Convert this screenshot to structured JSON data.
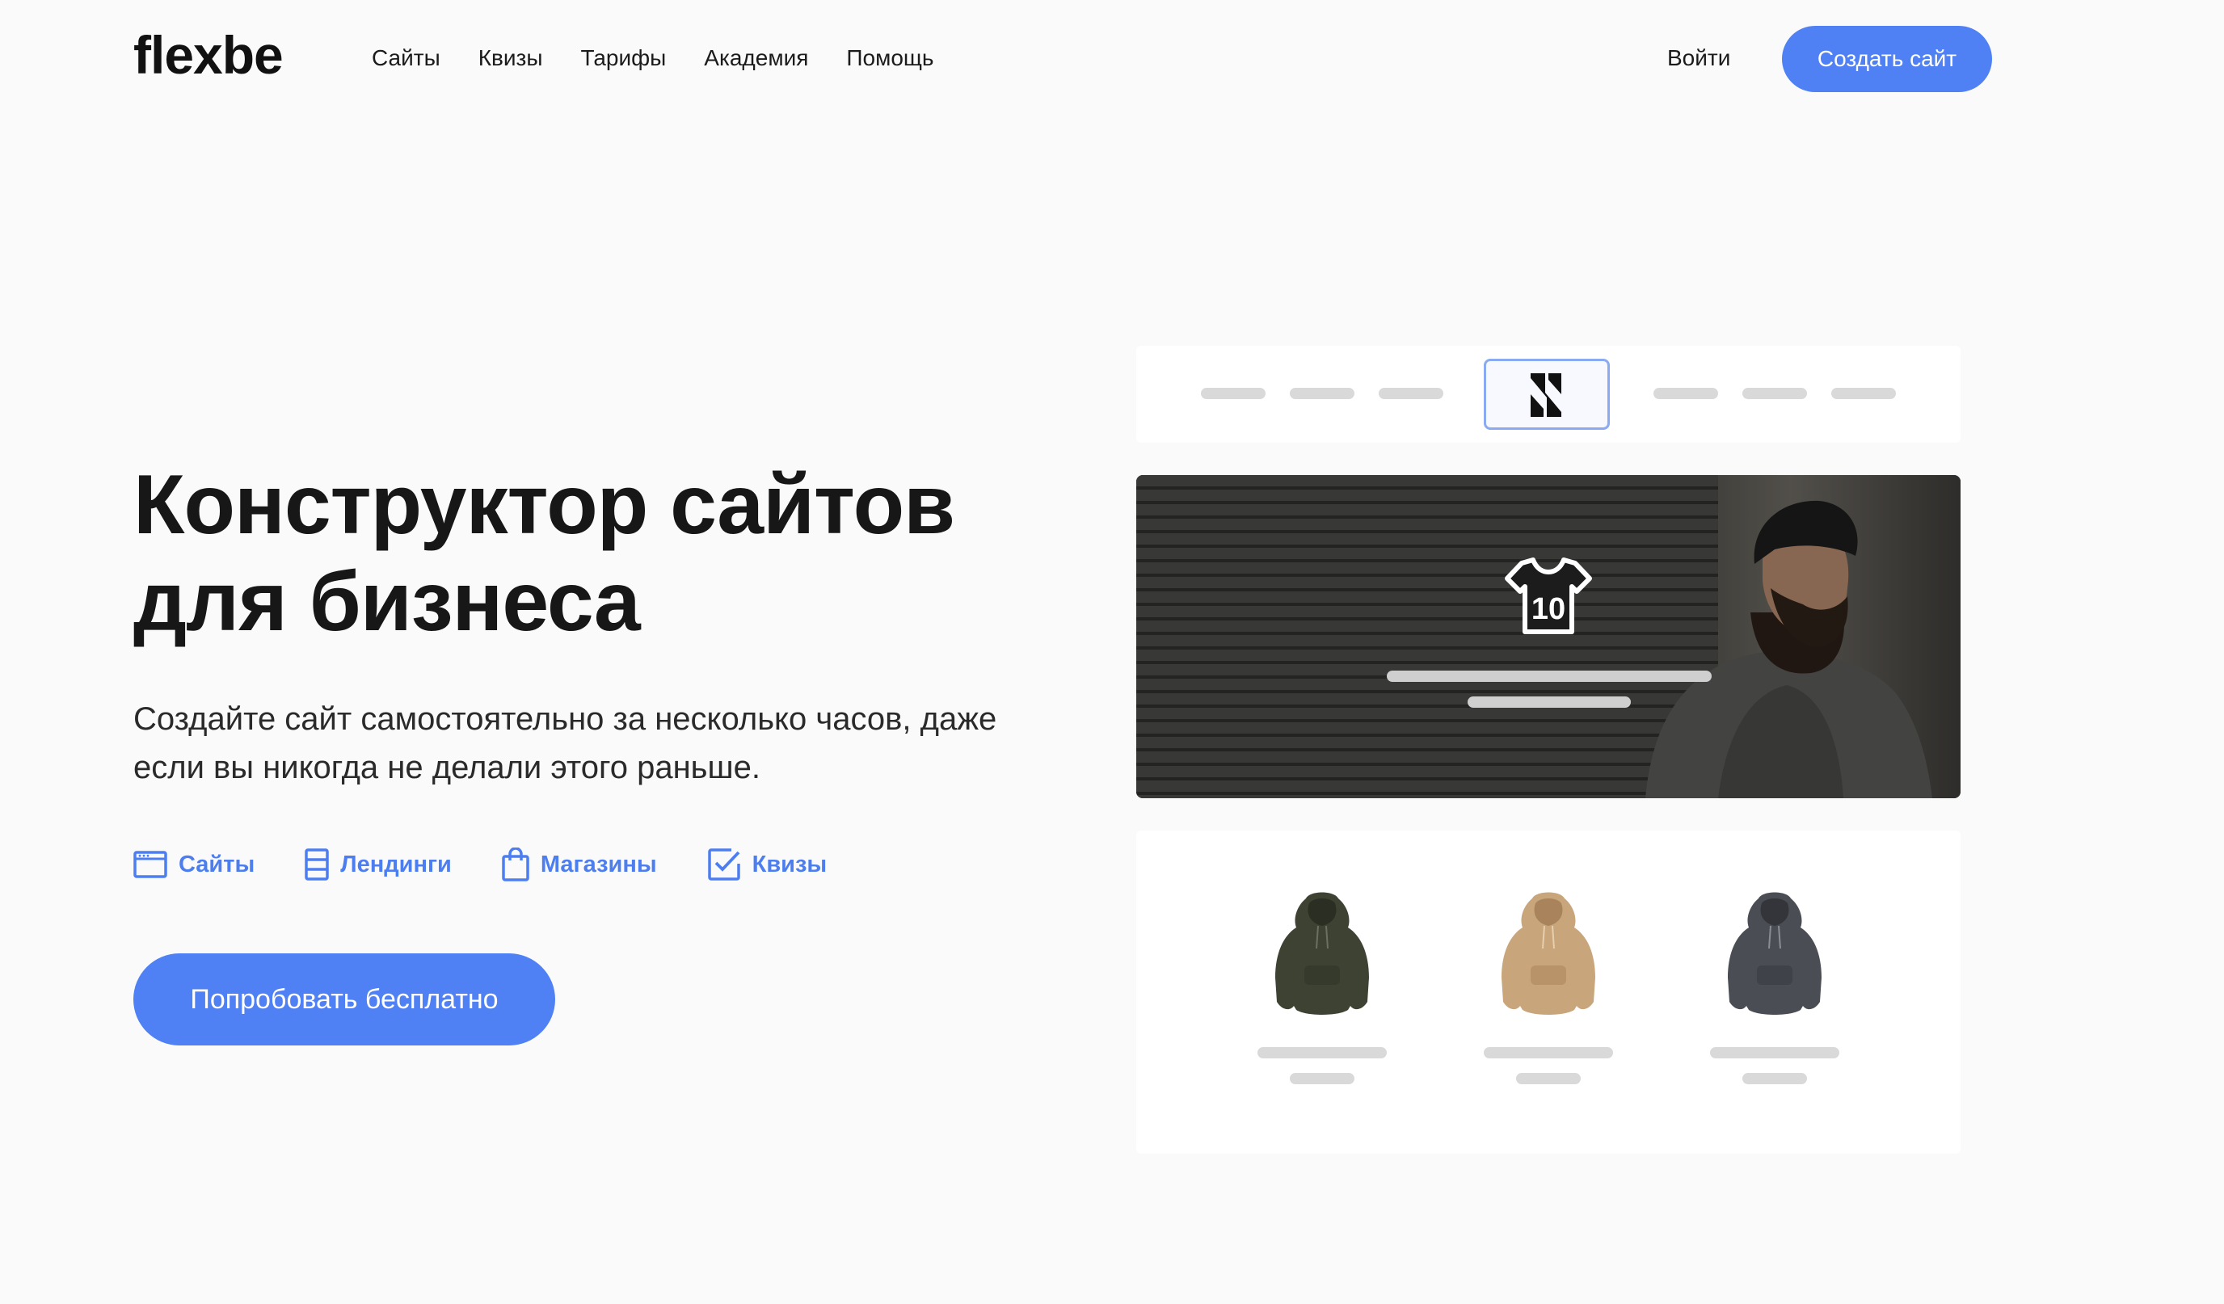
{
  "header": {
    "logo": "flexbe",
    "nav": [
      "Сайты",
      "Квизы",
      "Тарифы",
      "Академия",
      "Помощь"
    ],
    "login": "Войти",
    "create_site": "Создать сайт"
  },
  "hero": {
    "title_line1": "Конструктор сайтов",
    "title_line2": "для бизнеса",
    "subtitle_line1": "Создайте сайт самостоятельно за несколько часов, даже",
    "subtitle_line2": "если вы никогда не делали этого раньше.",
    "features": [
      {
        "label": "Сайты",
        "icon": "browser-window-icon"
      },
      {
        "label": "Лендинги",
        "icon": "landing-page-icon"
      },
      {
        "label": "Магазины",
        "icon": "shopping-bag-icon"
      },
      {
        "label": "Квизы",
        "icon": "checkbox-icon"
      }
    ],
    "try_free": "Попробовать бесплатно"
  },
  "mockup": {
    "tshirt_number": "10",
    "products": [
      {
        "icon": "hoodie-icon",
        "color": "#3d4233"
      },
      {
        "icon": "hoodie-icon",
        "color": "#c9a57c"
      },
      {
        "icon": "hoodie-icon",
        "color": "#4a4d54"
      }
    ]
  },
  "colors": {
    "accent": "#5081f4",
    "background": "#fafafa",
    "text": "#1b1b1b"
  }
}
